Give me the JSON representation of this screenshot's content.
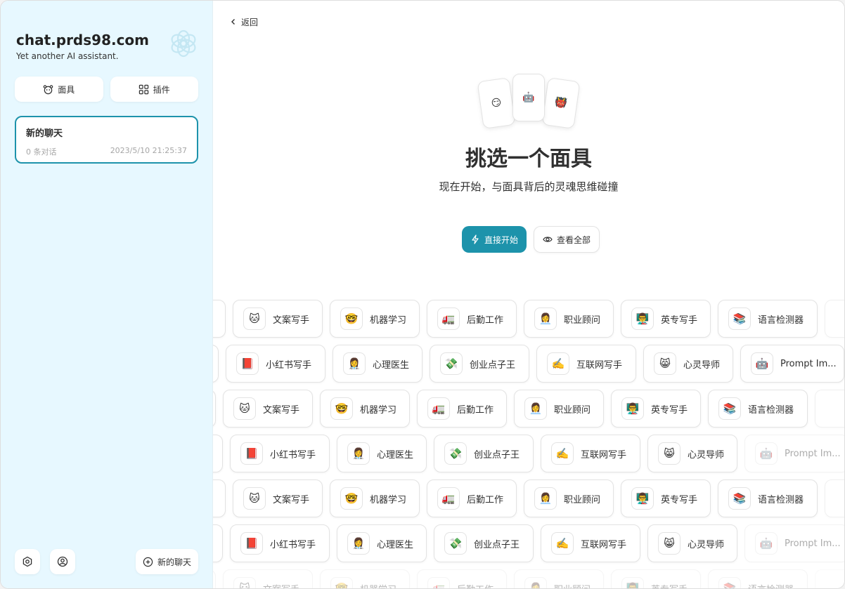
{
  "sidebar": {
    "title": "chat.prds98.com",
    "subtitle": "Yet another AI assistant.",
    "mask_button": "面具",
    "plugin_button": "插件",
    "chat": {
      "title": "新的聊天",
      "count": "0 条对话",
      "time": "2023/5/10 21:25:37"
    },
    "new_chat_button": "新的聊天"
  },
  "main": {
    "back_label": "返回",
    "title": "挑选一个面具",
    "subtitle": "现在开始，与面具背后的灵魂思维碰撞",
    "start_button": "直接开始",
    "view_all_button": "查看全部",
    "card_emojis": [
      "😏",
      "🤖",
      "👹"
    ]
  },
  "masks_a": [
    {
      "emoji": "🐱",
      "name": "文案写手"
    },
    {
      "emoji": "🤓",
      "name": "机器学习"
    },
    {
      "emoji": "🚛",
      "name": "后勤工作"
    },
    {
      "emoji": "👩‍💼",
      "name": "职业顾问"
    },
    {
      "emoji": "👨‍🏫",
      "name": "英专写手"
    },
    {
      "emoji": "📚",
      "name": "语言检测器"
    }
  ],
  "masks_b": [
    {
      "emoji": "📕",
      "name": "小红书写手"
    },
    {
      "emoji": "👩‍⚕️",
      "name": "心理医生"
    },
    {
      "emoji": "💸",
      "name": "创业点子王"
    },
    {
      "emoji": "✍️",
      "name": "互联网写手"
    },
    {
      "emoji": "😸",
      "name": "心灵导师"
    },
    {
      "emoji": "🤖",
      "name": "Prompt Im..."
    }
  ],
  "colors": {
    "accent": "#1d93ab",
    "sidebar_bg": "#e7f8ff"
  }
}
